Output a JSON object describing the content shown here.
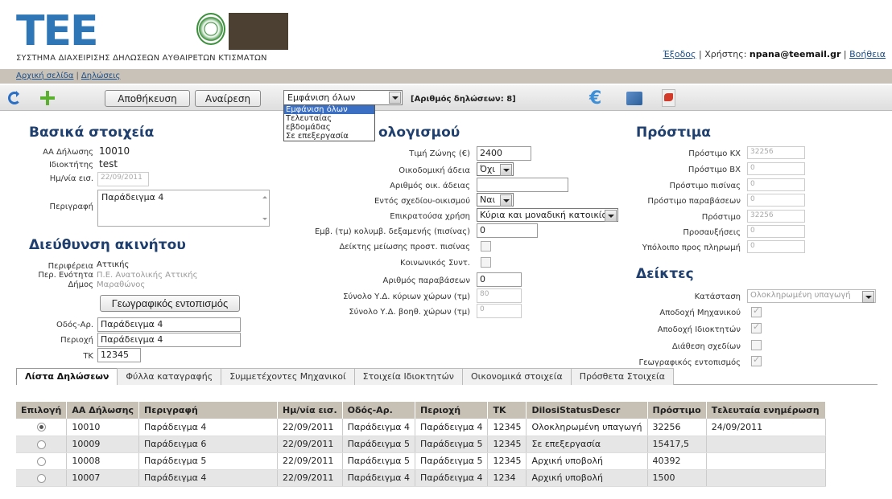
{
  "header": {
    "logo_text": "TEE",
    "system_title": "ΣΥΣΤΗΜΑ ΔΙΑΧΕΙΡΙΣΗΣ ΔΗΛΩΣΕΩΝ ΑΥΘΑΙΡΕΤΩΝ ΚΤΙΣΜΑΤΩΝ",
    "logout": "Έξοδος",
    "user_label": "Χρήστης:",
    "user": "npana@teemail.gr",
    "help": "Βοήθεια"
  },
  "breadcrumb": {
    "home": "Αρχική σελίδα",
    "declarations": "Δηλώσεις"
  },
  "toolbar": {
    "save": "Αποθήκευση",
    "cancel": "Αναίρεση",
    "filter_value": "Εμφάνιση όλων",
    "filter_options": [
      "Εμφάνιση όλων",
      "Τελευταίας εβδομάδας",
      "Σε επεξεργασία"
    ],
    "count_label": "[Αριθμός δηλώσεων: 8]"
  },
  "basic": {
    "title": "Βασικά στοιχεία",
    "aa_label": "ΑΑ Δήλωσης",
    "aa_value": "10010",
    "owner_label": "Ιδιοκτήτης",
    "owner_value": "test",
    "date_label": "Ημ/νία εισ.",
    "date_value": "22/09/2011",
    "desc_label": "Περιγραφή",
    "desc_value": "Παράδειγμα 4"
  },
  "address": {
    "title": "Διεύθυνση ακινήτου",
    "region_label": "Περιφέρεια",
    "region_value": "Αττικής",
    "unit_label": "Περ. Ενότητα",
    "unit_value": "Π.Ε. Ανατολικής Αττικής",
    "municipality_label": "Δήμος",
    "municipality_value": "Μαραθώνος",
    "geo_button": "Γεωγραφικός εντοπισμός",
    "street_label": "Οδός-Αρ.",
    "street_value": "Παράδειγμα 4",
    "area_label": "Περιοχή",
    "area_value": "Παράδειγμα 4",
    "zip_label": "ΤΚ",
    "zip_value": "12345"
  },
  "calc": {
    "title": "ολογισμού",
    "zone_price_label": "Τιμή Ζώνης (€)",
    "zone_price_value": "2400",
    "permit_label": "Οικοδομική άδεια",
    "permit_value": "Όχι",
    "permit_no_label": "Αριθμός οικ. άδειας",
    "permit_no_value": "",
    "in_plan_label": "Εντός σχεδίου-οικισμού",
    "in_plan_value": "Ναι",
    "use_label": "Επικρατούσα χρήση",
    "use_value": "Κύρια και μοναδική κατοικία",
    "pool_area_label": "Εμβ. (τμ) κολυμβ. δεξαμενής (πισίνας)",
    "pool_area_value": "0",
    "pool_index_label": "Δείκτης μείωσης προστ. πισίνας",
    "social_label": "Κοινωνικός Συντ.",
    "violations_label": "Αριθμός παραβάσεων",
    "violations_value": "0",
    "main_total_label": "Σύνολο Υ.Δ. κύριων χώρων (τμ)",
    "main_total_value": "80",
    "aux_total_label": "Σύνολο Υ.Δ. βοηθ. χώρων (τμ)",
    "aux_total_value": "0"
  },
  "fines": {
    "title": "Πρόστιμα",
    "rows": [
      {
        "label": "Πρόστιμο ΚΧ",
        "value": "32256"
      },
      {
        "label": "Πρόστιμο ΒΧ",
        "value": "0"
      },
      {
        "label": "Πρόστιμο πισίνας",
        "value": "0"
      },
      {
        "label": "Πρόστιμο παραβάσεων",
        "value": "0"
      },
      {
        "label": "Πρόστιμο",
        "value": "32256"
      },
      {
        "label": "Προσαυξήσεις",
        "value": "0"
      },
      {
        "label": "Υπόλοιπο προς πληρωμή",
        "value": "0"
      }
    ]
  },
  "indicators": {
    "title": "Δείκτες",
    "status_label": "Κατάσταση",
    "status_value": "Ολοκληρωμένη υπαγωγή",
    "engineer_label": "Αποδοχή Μηχανικού",
    "owners_label": "Αποδοχή Ιδιοκτητών",
    "plans_label": "Διάθεση σχεδίων",
    "geo_label": "Γεωγραφικός εντοπισμός"
  },
  "tabs": [
    "Λίστα Δηλώσεων",
    "Φύλλα καταγραφής",
    "Συμμετέχοντες Μηχανικοί",
    "Στοιχεία Ιδιοκτητών",
    "Οικονομικά στοιχεία",
    "Πρόσθετα Στοιχεία"
  ],
  "table": {
    "headers": [
      "Επιλογή",
      "ΑΑ Δήλωσης",
      "Περιγραφή",
      "Ημ/νία εισ.",
      "Οδός-Αρ.",
      "Περιοχή",
      "ΤΚ",
      "DilosiStatusDescr",
      "Πρόστιμο",
      "Τελευταία ενημέρωση"
    ],
    "rows": [
      {
        "aa": "10010",
        "desc": "Παράδειγμα 4",
        "date": "22/09/2011",
        "street": "Παράδειγμα 4",
        "area": "Παράδειγμα 4",
        "zip": "12345",
        "status": "Ολοκληρωμένη υπαγωγή",
        "fine": "32256",
        "updated": "24/09/2011"
      },
      {
        "aa": "10009",
        "desc": "Παράδειγμα 6",
        "date": "22/09/2011",
        "street": "Παράδειγμα 5",
        "area": "Παράδειγμα 5",
        "zip": "12345",
        "status": "Σε επεξεργασία",
        "fine": "15417,5",
        "updated": ""
      },
      {
        "aa": "10008",
        "desc": "Παράδειγμα 5",
        "date": "22/09/2011",
        "street": "Παράδειγμα 5",
        "area": "Παράδειγμα 5",
        "zip": "12345",
        "status": "Αρχική υποβολή",
        "fine": "40392",
        "updated": ""
      },
      {
        "aa": "10007",
        "desc": "Παράδειγμα 4",
        "date": "22/09/2011",
        "street": "Παράδειγμα 4",
        "area": "Παράδειγμα 4",
        "zip": "1234",
        "status": "Αρχική υποβολή",
        "fine": "1500",
        "updated": ""
      }
    ]
  }
}
